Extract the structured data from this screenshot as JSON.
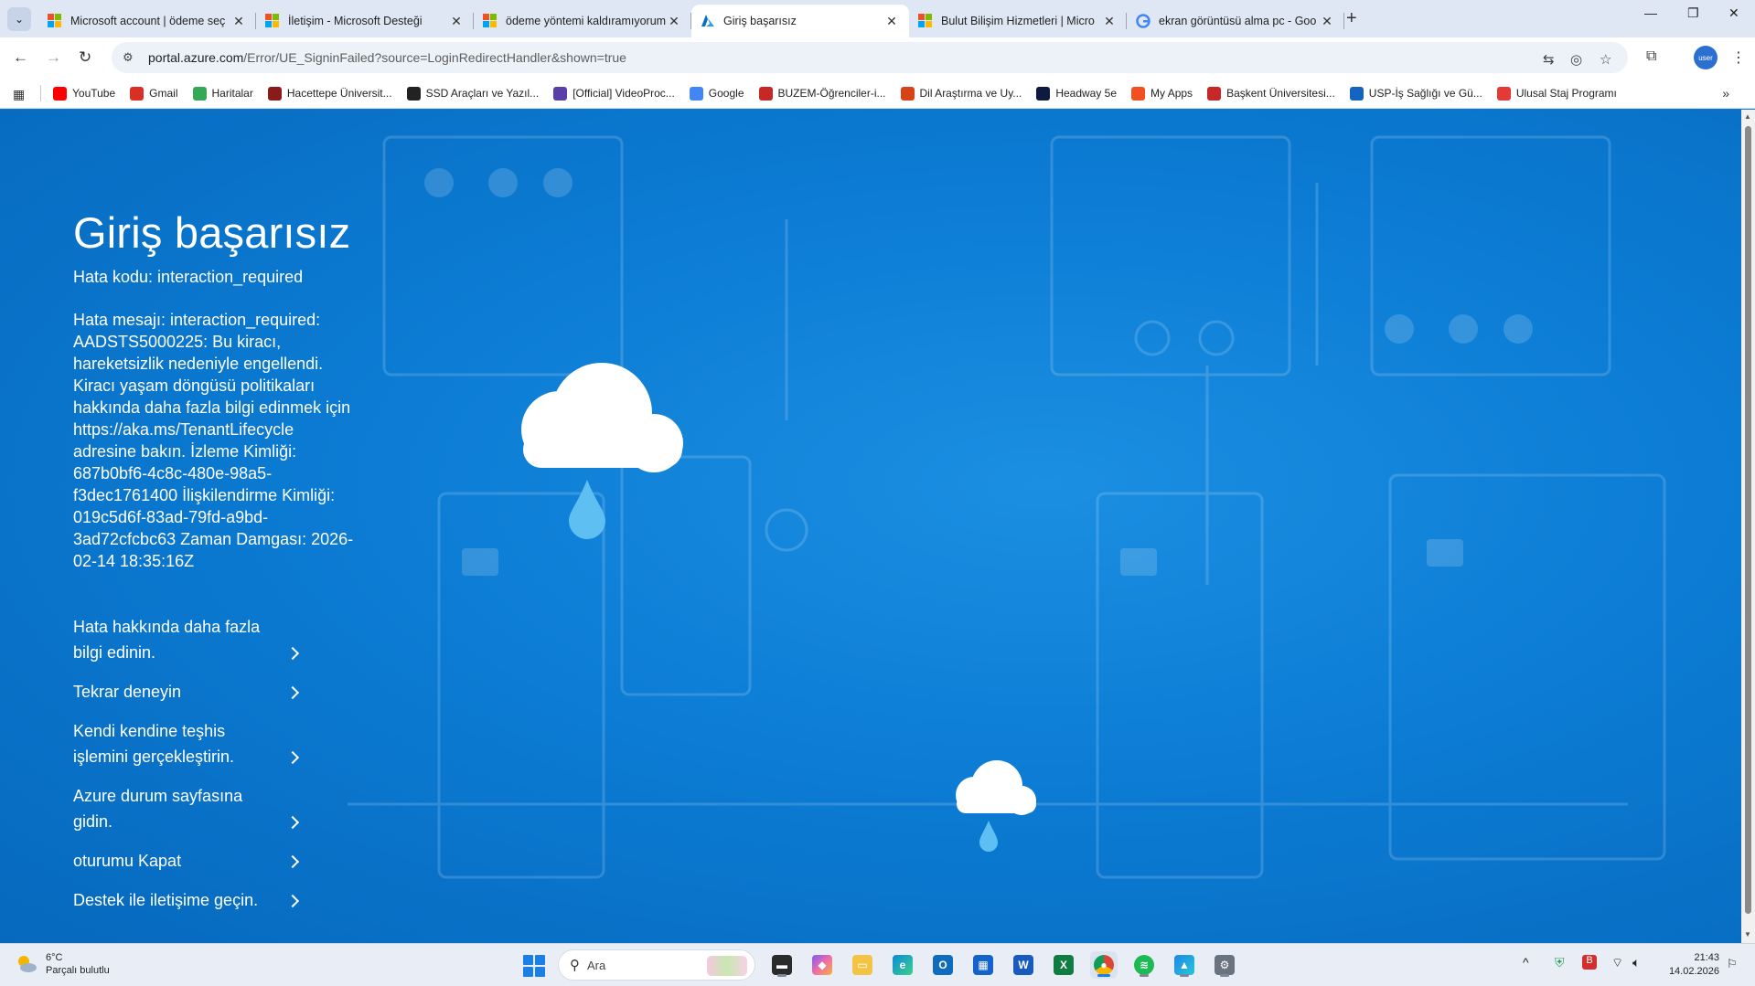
{
  "browser": {
    "tabs": [
      {
        "title": "Microsoft account | ödeme seç",
        "favicon": "microsoft-logo",
        "active": false
      },
      {
        "title": "İletişim - Microsoft Desteği",
        "favicon": "microsoft-logo",
        "active": false
      },
      {
        "title": "ödeme yöntemi kaldıramıyorum",
        "favicon": "microsoft-logo",
        "active": false
      },
      {
        "title": "Giriş başarısız",
        "favicon": "azure-logo",
        "active": true
      },
      {
        "title": "Bulut Bilişim Hizmetleri | Micro",
        "favicon": "microsoft-logo",
        "active": false
      },
      {
        "title": "ekran görüntüsü alma pc - Goo",
        "favicon": "google-logo",
        "active": false
      }
    ],
    "new_tab_glyph": "+",
    "address": {
      "host": "portal.azure.com",
      "path": "/Error/UE_SigninFailed?source=LoginRedirectHandler&shown=true"
    },
    "profile_label": "user"
  },
  "bookmarks": [
    {
      "label": "YouTube",
      "icon": "youtube-icon",
      "color": "#ff0000"
    },
    {
      "label": "Gmail",
      "icon": "gmail-icon",
      "color": "#d93025"
    },
    {
      "label": "Haritalar",
      "icon": "maps-icon",
      "color": "#34a853"
    },
    {
      "label": "Hacettepe Üniversit...",
      "icon": "hacettepe-icon",
      "color": "#8b1a1a"
    },
    {
      "label": "SSD Araçları ve Yazıl...",
      "icon": "ssd-icon",
      "color": "#222222"
    },
    {
      "label": "[Official] VideoProc...",
      "icon": "videoproc-icon",
      "color": "#5b3fa8"
    },
    {
      "label": "Google",
      "icon": "google-icon",
      "color": "#4285f4"
    },
    {
      "label": "BUZEM-Öğrenciler-i...",
      "icon": "buzem-icon",
      "color": "#c62828"
    },
    {
      "label": "Dil Araştırma ve Uy...",
      "icon": "dil-icon",
      "color": "#d84315"
    },
    {
      "label": "Headway 5e",
      "icon": "headway-icon",
      "color": "#0d1b3e"
    },
    {
      "label": "My Apps",
      "icon": "myapps-icon",
      "color": "#f25022"
    },
    {
      "label": "Başkent Üniversitesi...",
      "icon": "baskent-icon",
      "color": "#c62828"
    },
    {
      "label": "USP-İş Sağlığı ve Gü...",
      "icon": "usp-icon",
      "color": "#1565c0"
    },
    {
      "label": "Ulusal Staj Programı",
      "icon": "ulusal-icon",
      "color": "#e53935"
    }
  ],
  "page": {
    "title": "Giriş başarısız",
    "error_code": "Hata kodu: interaction_required",
    "error_message": "Hata mesajı: interaction_required: AADSTS5000225: Bu kiracı, hareketsizlik nedeniyle engellendi. Kiracı yaşam döngüsü politikaları hakkında daha fazla bilgi edinmek için https://aka.ms/TenantLifecycle adresine bakın. İzleme Kimliği: 687b0bf6-4c8c-480e-98a5-f3dec1761400 İlişkilendirme Kimliği: 019c5d6f-83ad-79fd-a9bd-3ad72cfcbc63 Zaman Damgası: 2026-02-14 18:35:16Z",
    "links": [
      {
        "label": "Hata hakkında daha fazla bilgi edinin."
      },
      {
        "label": "Tekrar deneyin"
      },
      {
        "label": "Kendi kendine teşhis işlemini gerçekleştirin."
      },
      {
        "label": "Azure durum sayfasına gidin."
      },
      {
        "label": "oturumu Kapat"
      },
      {
        "label": "Destek ile iletişime geçin."
      }
    ],
    "colors": {
      "background": "#0a78d1",
      "text": "#ffffff"
    }
  },
  "taskbar": {
    "weather": {
      "temp": "6°C",
      "desc": "Parçalı bulutlu"
    },
    "search_placeholder": "Ara",
    "apps": [
      "file-explorer-icon",
      "copilot-icon",
      "folder-icon",
      "edge-icon",
      "outlook-icon",
      "store-icon",
      "word-icon",
      "excel-icon",
      "chrome-icon",
      "spotify-icon",
      "photos-icon",
      "settings-icon"
    ],
    "clock": {
      "time": "21:43",
      "date": "14.02.2026"
    }
  }
}
